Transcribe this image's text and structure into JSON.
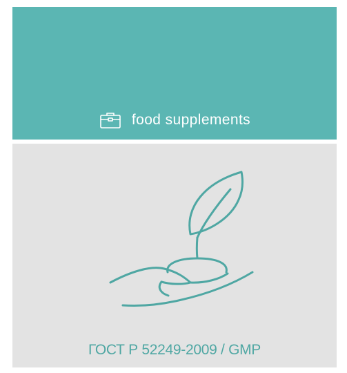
{
  "top_card": {
    "icon": "briefcase-icon",
    "label": "food supplements",
    "background": "#5bb6b3",
    "text_color": "#ffffff"
  },
  "bottom_card": {
    "illustration": "plant-in-hand-icon",
    "caption": "ГОСТ Р 52249-2009 / GMP",
    "background": "#e3e3e3",
    "accent_color": "#4fa7a3"
  }
}
